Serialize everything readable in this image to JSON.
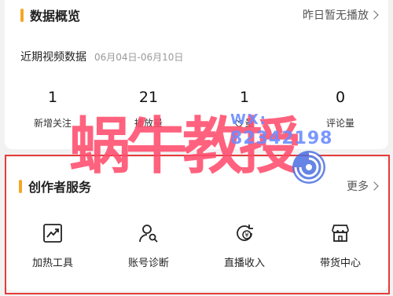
{
  "overview": {
    "title": "数据概览",
    "right_text": "昨日暂无播放",
    "recent_title": "近期视频数据",
    "date_range": "06月04日-06月10日",
    "stats": [
      {
        "value": "1",
        "label": "新增关注"
      },
      {
        "value": "21",
        "label": "播放量"
      },
      {
        "value": "1",
        "label": "量"
      },
      {
        "value": "0",
        "label": "评论量"
      }
    ]
  },
  "services": {
    "title": "创作者服务",
    "more_label": "更多",
    "items": [
      {
        "label": "加热工具",
        "icon": "trend-chart-icon"
      },
      {
        "label": "账号诊断",
        "icon": "user-search-icon"
      },
      {
        "label": "直播收入",
        "icon": "yuan-refresh-icon"
      },
      {
        "label": "带货中心",
        "icon": "store-icon"
      }
    ]
  },
  "watermark": {
    "chars": "蜗牛教授",
    "wx": "WX:",
    "number": "82342198"
  },
  "colors": {
    "accent": "#f5a623",
    "highlight_frame": "#e63b3b",
    "watermark_pink": "#ff4d6d",
    "watermark_blue": "#6c8cff"
  }
}
